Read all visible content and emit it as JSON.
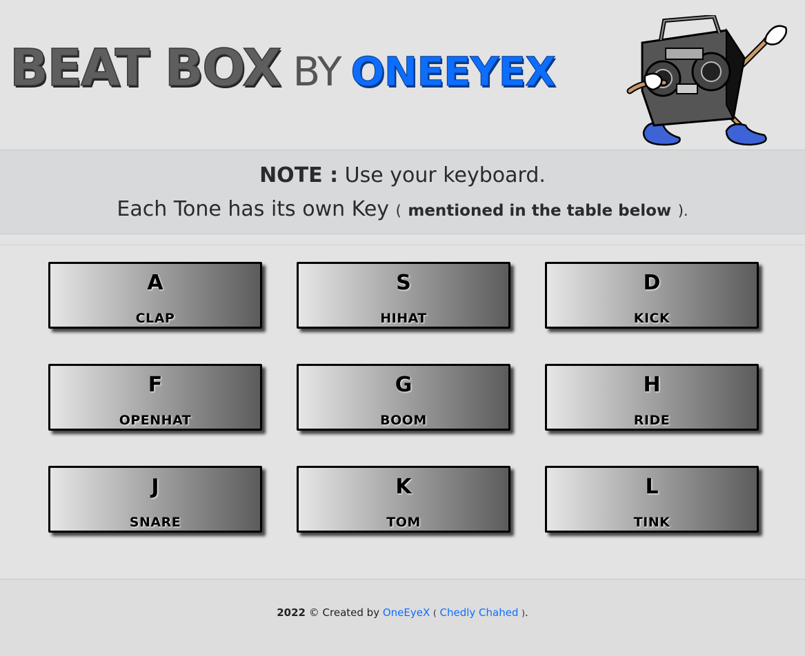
{
  "header": {
    "title_main": "BEAT BOX",
    "title_by": "BY",
    "title_brand": "ONEEYEX",
    "brand_color": "#0d6efd",
    "mascot": "dabbing-boombox-icon"
  },
  "note": {
    "label": "NOTE :",
    "text1": "Use your keyboard.",
    "text2": "Each Tone has its own Key",
    "open_paren": "(",
    "emphasis": "mentioned in the table below",
    "close_paren": ").",
    "end": ""
  },
  "keys": [
    {
      "key": "A",
      "sound": "CLAP"
    },
    {
      "key": "S",
      "sound": "HIHAT"
    },
    {
      "key": "D",
      "sound": "KICK"
    },
    {
      "key": "F",
      "sound": "OPENHAT"
    },
    {
      "key": "G",
      "sound": "BOOM"
    },
    {
      "key": "H",
      "sound": "RIDE"
    },
    {
      "key": "J",
      "sound": "SNARE"
    },
    {
      "key": "K",
      "sound": "TOM"
    },
    {
      "key": "L",
      "sound": "TINK"
    }
  ],
  "footer": {
    "year": "2022",
    "copyright": "©",
    "created_by": "Created by",
    "author_link": "OneEyeX",
    "open_paren": "(",
    "name_link": "Chedly Chahed",
    "close_paren": ")",
    "end": "."
  }
}
